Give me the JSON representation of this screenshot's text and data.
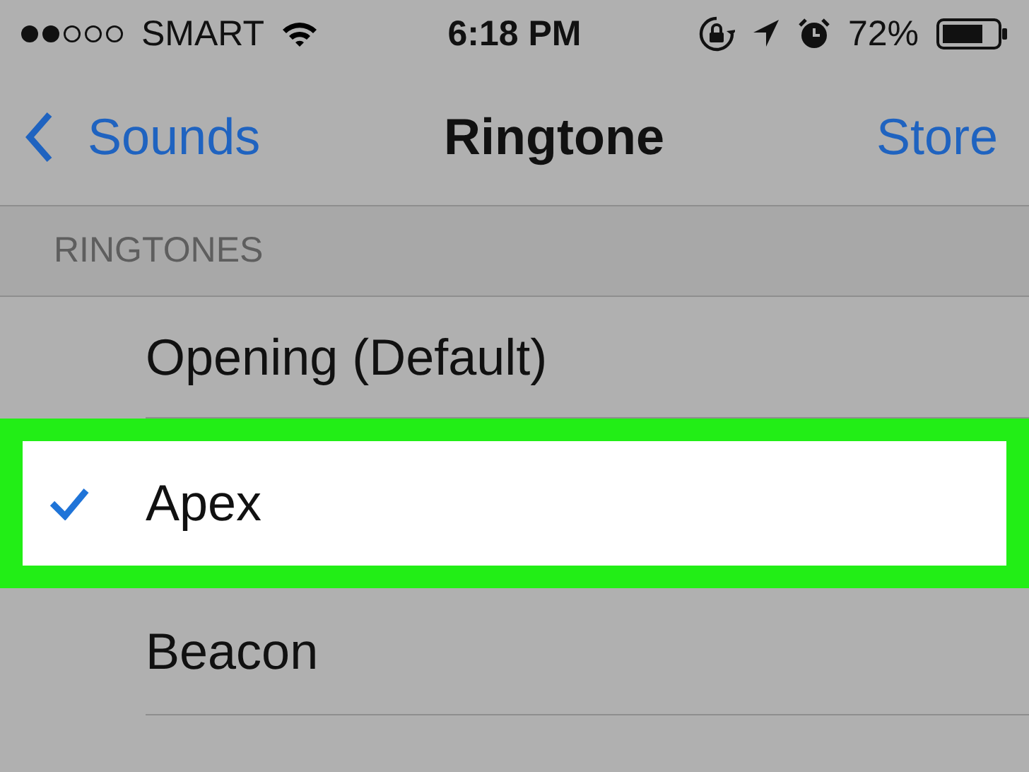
{
  "status_bar": {
    "carrier": "SMART",
    "time": "6:18 PM",
    "battery": "72%"
  },
  "nav": {
    "back": "Sounds",
    "title": "Ringtone",
    "action": "Store"
  },
  "section": {
    "header": "RINGTONES"
  },
  "rows": [
    {
      "label": "Opening (Default)",
      "checked": false,
      "highlighted": false
    },
    {
      "label": "Apex",
      "checked": true,
      "highlighted": true
    },
    {
      "label": "Beacon",
      "checked": false,
      "highlighted": false
    }
  ]
}
